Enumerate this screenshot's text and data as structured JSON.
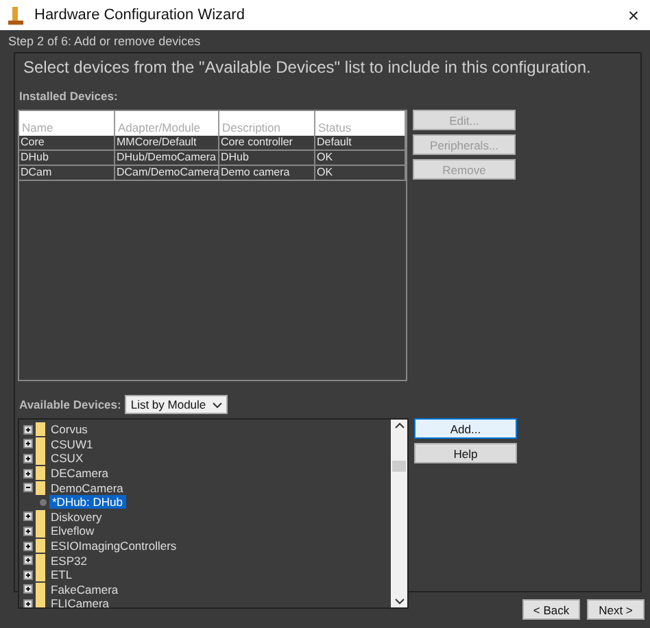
{
  "window": {
    "title": "Hardware Configuration Wizard",
    "close": "×"
  },
  "step": "Step 2 of 6: Add or remove devices",
  "instruction": "Select devices from the \"Available Devices\" list to include in this configuration.",
  "installed": {
    "label": "Installed Devices:",
    "columns": [
      "Name",
      "Adapter/Module",
      "Description",
      "Status"
    ],
    "rows": [
      [
        "Core",
        "MMCore/Default",
        "Core controller",
        "Default"
      ],
      [
        "DHub",
        "DHub/DemoCamera",
        "DHub",
        "OK"
      ],
      [
        "DCam",
        "DCam/DemoCamera",
        "Demo camera",
        "OK"
      ]
    ],
    "buttons": [
      {
        "label": "Edit...",
        "disabled": true
      },
      {
        "label": "Peripherals...",
        "disabled": true
      },
      {
        "label": "Remove",
        "disabled": true
      }
    ]
  },
  "available": {
    "label": "Available Devices:",
    "mode": "List by Module",
    "tree": [
      {
        "label": "Corvus",
        "expanded": false
      },
      {
        "label": "CSUW1",
        "expanded": false
      },
      {
        "label": "CSUX",
        "expanded": false
      },
      {
        "label": "DECamera",
        "expanded": false
      },
      {
        "label": "DemoCamera",
        "expanded": true,
        "children": [
          {
            "label": "*DHub: DHub",
            "selected": true
          }
        ]
      },
      {
        "label": "Diskovery",
        "expanded": false
      },
      {
        "label": "Elveflow",
        "expanded": false
      },
      {
        "label": "ESIOImagingControllers",
        "expanded": false
      },
      {
        "label": "ESP32",
        "expanded": false
      },
      {
        "label": "ETL",
        "expanded": false
      },
      {
        "label": "FakeCamera",
        "expanded": false
      },
      {
        "label": "FLICamera",
        "expanded": false
      }
    ],
    "buttons": [
      {
        "label": "Add...",
        "focused": true
      },
      {
        "label": "Help",
        "focused": false
      }
    ]
  },
  "footer": [
    "< Back",
    "Next >"
  ]
}
